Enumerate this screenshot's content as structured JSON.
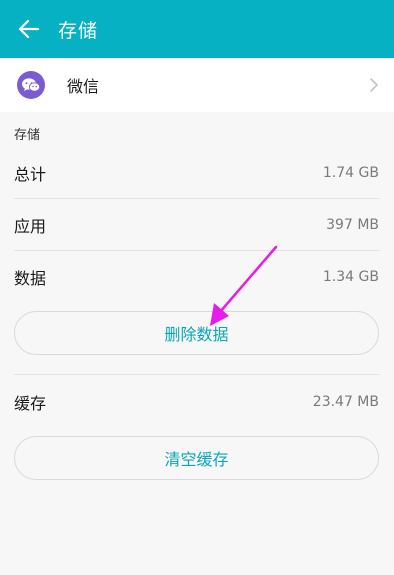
{
  "header": {
    "back_icon": "arrow-left-icon",
    "title": "存储",
    "color": "#06b1c3"
  },
  "app_row": {
    "icon": "wechat-icon",
    "icon_color": "#7a5bd0",
    "name": "微信",
    "chevron_icon": "chevron-right-icon"
  },
  "storage": {
    "section_label": "存储",
    "rows": [
      {
        "label": "总计",
        "value": "1.74 GB"
      },
      {
        "label": "应用",
        "value": "397 MB"
      },
      {
        "label": "数据",
        "value": "1.34 GB"
      }
    ],
    "clear_data_label": "删除数据",
    "cache": {
      "label": "缓存",
      "value": "23.47 MB"
    },
    "clear_cache_label": "清空缓存"
  },
  "accent_color": "#0aa7ba",
  "annotation_color": "#e81ce8"
}
